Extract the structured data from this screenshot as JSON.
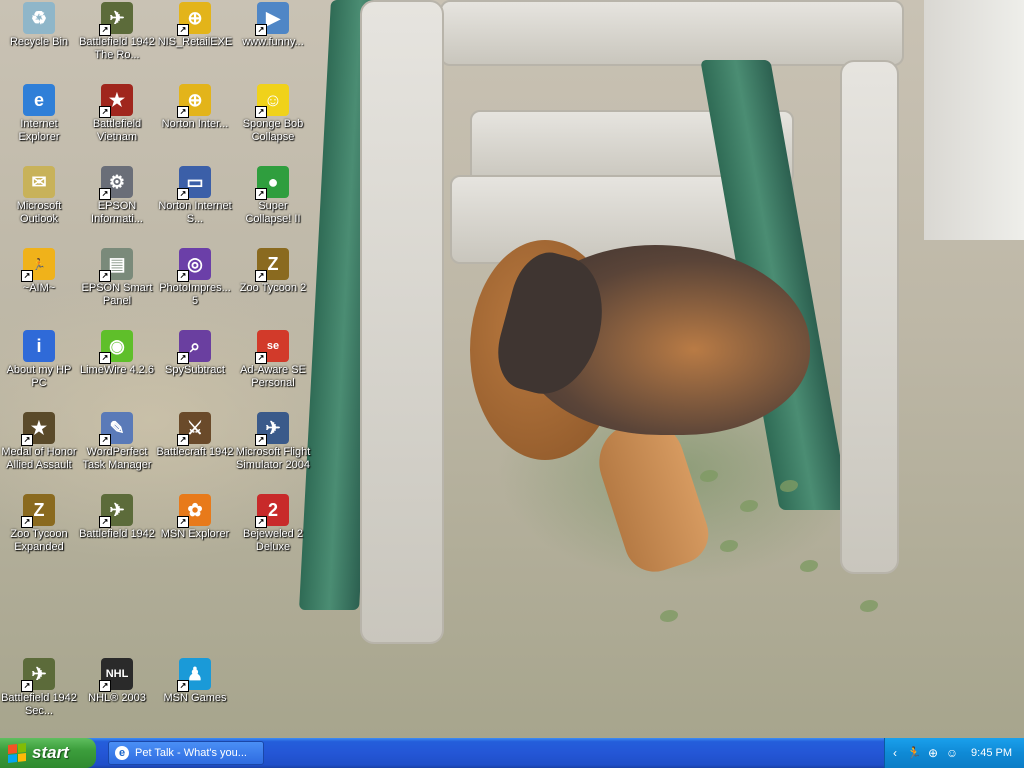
{
  "desktop_icons": [
    {
      "name": "recycle-bin",
      "label": "Recycle Bin",
      "glyph": "♻",
      "color": "#8fb6c9",
      "shortcut": false
    },
    {
      "name": "battlefield-1942-road",
      "label": "Battlefield 1942 The Ro...",
      "glyph": "✈",
      "color": "#5c6b3a",
      "shortcut": true
    },
    {
      "name": "nis-retail",
      "label": "NIS_RetailEXE",
      "glyph": "⊕",
      "color": "#e3b41a",
      "shortcut": true
    },
    {
      "name": "funny-link",
      "label": "www.funny...",
      "glyph": "▶",
      "color": "#4f86c6",
      "shortcut": true
    },
    {
      "name": "internet-explorer",
      "label": "Internet Explorer",
      "glyph": "e",
      "color": "#2f7fd8",
      "shortcut": false
    },
    {
      "name": "battlefield-vietnam",
      "label": "Battlefield Vietnam",
      "glyph": "★",
      "color": "#a0261d",
      "shortcut": true
    },
    {
      "name": "norton-internet-security",
      "label": "Norton Inter...",
      "glyph": "⊕",
      "color": "#e3b41a",
      "shortcut": true
    },
    {
      "name": "spongebob-collapse",
      "label": "Sponge Bob Collapse",
      "glyph": "☺",
      "color": "#f0d21a",
      "shortcut": true
    },
    {
      "name": "microsoft-outlook",
      "label": "Microsoft Outlook",
      "glyph": "✉",
      "color": "#c8b25a",
      "shortcut": false
    },
    {
      "name": "epson-information",
      "label": "EPSON Informati...",
      "glyph": "⚙",
      "color": "#6a6e78",
      "shortcut": true
    },
    {
      "name": "norton-internet-5",
      "label": "Norton Internet S...",
      "glyph": "▭",
      "color": "#3b5fa8",
      "shortcut": true
    },
    {
      "name": "super-collapse",
      "label": "Super Collapse! II",
      "glyph": "●",
      "color": "#2f9e3e",
      "shortcut": true
    },
    {
      "name": "aim",
      "label": "~AIM~",
      "glyph": "🏃",
      "color": "#f0b21a",
      "shortcut": true
    },
    {
      "name": "epson-smart-panel",
      "label": "EPSON Smart Panel",
      "glyph": "▤",
      "color": "#7a8a7a",
      "shortcut": true
    },
    {
      "name": "photoimpression",
      "label": "PhotoImpres... 5",
      "glyph": "◎",
      "color": "#6b3fa8",
      "shortcut": true
    },
    {
      "name": "zoo-tycoon-2",
      "label": "Zoo Tycoon 2",
      "glyph": "Z",
      "color": "#8a6a1f",
      "shortcut": true
    },
    {
      "name": "about-my-hp-pc",
      "label": "About my HP PC",
      "glyph": "i",
      "color": "#2f6ad8",
      "shortcut": false
    },
    {
      "name": "limewire",
      "label": "LimeWire 4.2.6",
      "glyph": "◉",
      "color": "#5fbf2a",
      "shortcut": true
    },
    {
      "name": "spysubtract",
      "label": "SpySubtract",
      "glyph": "⌕",
      "color": "#6a3fa0",
      "shortcut": true
    },
    {
      "name": "ad-aware",
      "label": "Ad-Aware SE Personal",
      "glyph": "se",
      "color": "#d23a2a",
      "shortcut": true
    },
    {
      "name": "medal-of-honor",
      "label": "Medal of Honor Allied Assault",
      "glyph": "★",
      "color": "#5a4a2a",
      "shortcut": true
    },
    {
      "name": "wordperfect-task-manager",
      "label": "WordPerfect Task Manager",
      "glyph": "✎",
      "color": "#5a7ab8",
      "shortcut": true
    },
    {
      "name": "battlecraft-1942",
      "label": "Battlecraft 1942",
      "glyph": "⚔",
      "color": "#6a4a2a",
      "shortcut": true
    },
    {
      "name": "flight-simulator",
      "label": "Microsoft Flight Simulator 2004",
      "glyph": "✈",
      "color": "#3a5a8a",
      "shortcut": true
    },
    {
      "name": "zoo-tycoon-expanded",
      "label": "Zoo Tycoon Expanded",
      "glyph": "Z",
      "color": "#8a6a1f",
      "shortcut": true
    },
    {
      "name": "battlefield-1942",
      "label": "Battlefield 1942",
      "glyph": "✈",
      "color": "#5c6b3a",
      "shortcut": true
    },
    {
      "name": "msn-explorer",
      "label": "MSN Explorer",
      "glyph": "✿",
      "color": "#e87a1a",
      "shortcut": true
    },
    {
      "name": "bejeweled-2",
      "label": "Bejeweled 2 Deluxe",
      "glyph": "2",
      "color": "#c82a2a",
      "shortcut": true
    },
    {
      "name": "battlefield-1942-secret",
      "label": "Battlefield 1942 Sec...",
      "glyph": "✈",
      "color": "#5c6b3a",
      "shortcut": true
    },
    {
      "name": "nhl-2003",
      "label": "NHL® 2003",
      "glyph": "NHL",
      "color": "#2a2a2a",
      "shortcut": true
    },
    {
      "name": "msn-games",
      "label": "MSN Games",
      "glyph": "♟",
      "color": "#1a9ad8",
      "shortcut": true
    }
  ],
  "taskbar": {
    "start_label": "start",
    "task_item_label": "Pet Talk - What's you...",
    "clock": "9:45 PM",
    "tray_icons": [
      {
        "name": "tray-arrow-icon",
        "glyph": "‹"
      },
      {
        "name": "tray-aim-icon",
        "glyph": "🏃"
      },
      {
        "name": "tray-norton-icon",
        "glyph": "⊕"
      },
      {
        "name": "tray-users-icon",
        "glyph": "☺"
      }
    ]
  }
}
